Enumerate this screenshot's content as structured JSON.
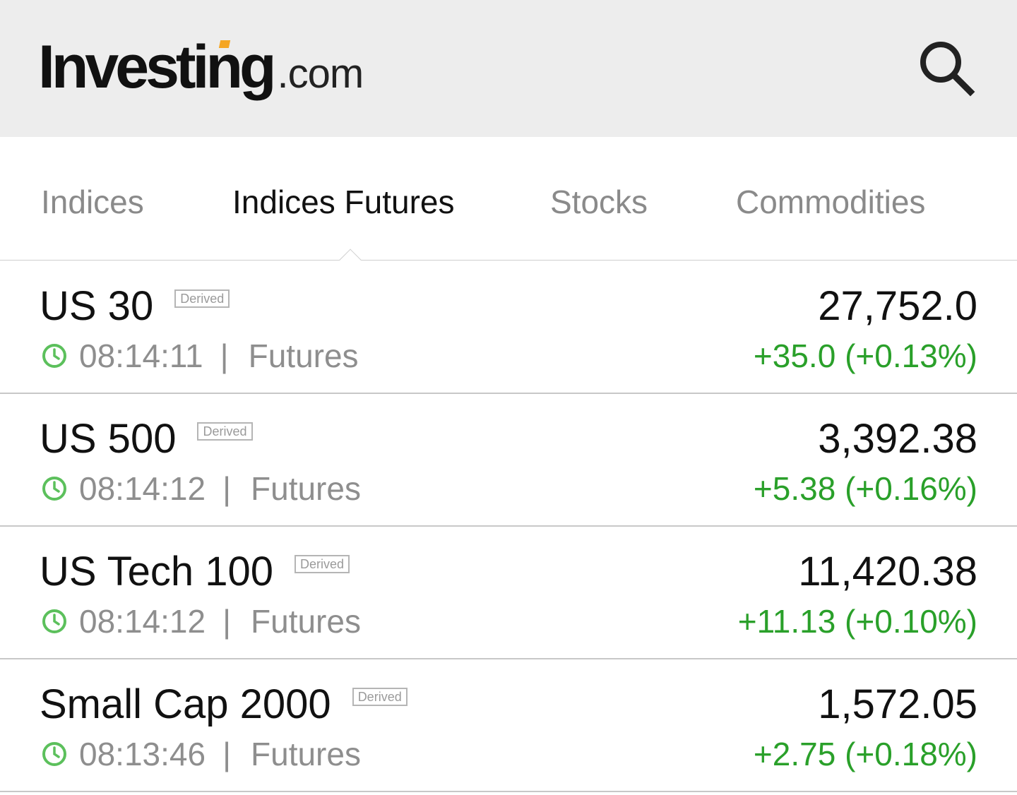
{
  "header": {
    "logo_main": "Investing",
    "logo_suffix": ".com",
    "logo_accent_color": "#f5a623",
    "search_icon": "search-icon"
  },
  "tabs": [
    {
      "label": "Indices",
      "active": false
    },
    {
      "label": "Indices Futures",
      "active": true
    },
    {
      "label": "Stocks",
      "active": false
    },
    {
      "label": "Commodities",
      "active": false
    }
  ],
  "rows": [
    {
      "name": "US 30",
      "badge": "Derived",
      "time": "08:14:11",
      "sep": "|",
      "type": "Futures",
      "price": "27,752.0",
      "change": "+35.0 (+0.13%)"
    },
    {
      "name": "US 500",
      "badge": "Derived",
      "time": "08:14:12",
      "sep": "|",
      "type": "Futures",
      "price": "3,392.38",
      "change": "+5.38 (+0.16%)"
    },
    {
      "name": "US Tech 100",
      "badge": "Derived",
      "time": "08:14:12",
      "sep": "|",
      "type": "Futures",
      "price": "11,420.38",
      "change": "+11.13 (+0.10%)"
    },
    {
      "name": "Small Cap 2000",
      "badge": "Derived",
      "time": "08:13:46",
      "sep": "|",
      "type": "Futures",
      "price": "1,572.05",
      "change": "+2.75 (+0.18%)"
    }
  ],
  "colors": {
    "positive": "#2aa02a",
    "clock": "#5cc05c",
    "header_bg": "#ededed"
  }
}
